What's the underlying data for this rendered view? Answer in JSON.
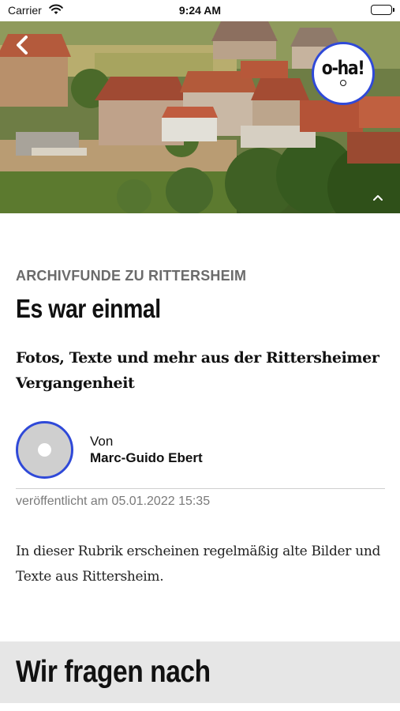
{
  "status_bar": {
    "carrier": "Carrier",
    "time": "9:24 AM"
  },
  "hero": {
    "badge_text": "o-ha!",
    "icons": [
      "chevron-left-icon",
      "chevron-up-icon",
      "wifi-icon",
      "battery-icon"
    ],
    "badge_border_color": "#2f49d8"
  },
  "article": {
    "kicker": "ARCHIVFUNDE ZU RITTERSHEIM",
    "headline": "Es war einmal",
    "teaser": "Fotos, Texte und mehr aus der Rittersheimer Vergangenheit",
    "author_prefix": "Von",
    "author_name": "Marc-Guido Ebert",
    "published": "veröffentlicht am 05.01.2022 15:35",
    "body": "In dieser Rubrik erscheinen regelmäßig alte Bilder und Texte aus Rittersheim."
  },
  "section": {
    "title": "Wir fragen nach"
  }
}
